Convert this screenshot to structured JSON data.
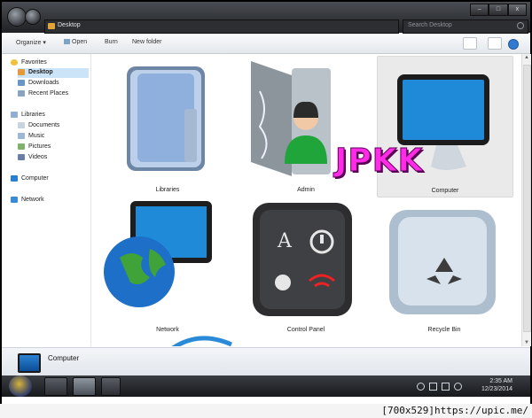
{
  "window": {
    "address_path": "Desktop",
    "search_placeholder": "Search Desktop",
    "controls": {
      "minimize": "–",
      "maximize": "□",
      "close": "x"
    }
  },
  "toolbar": {
    "organize": "Organize",
    "open": "Open",
    "burn": "Burn",
    "new_folder": "New folder"
  },
  "sidebar": {
    "favorites": "Favorites",
    "desktop": "Desktop",
    "downloads": "Downloads",
    "recent": "Recent Places",
    "libraries": "Libraries",
    "documents": "Documents",
    "music": "Music",
    "pictures": "Pictures",
    "videos": "Videos",
    "computer": "Computer",
    "network": "Network"
  },
  "items": [
    {
      "label": "Libraries"
    },
    {
      "label": "Admin"
    },
    {
      "label": "Computer"
    },
    {
      "label": "Network"
    },
    {
      "label": "Control Panel"
    },
    {
      "label": "Recycle Bin"
    }
  ],
  "details": {
    "label": "Computer"
  },
  "taskbar": {
    "time": "2:35 AM",
    "date": "12/23/2014"
  },
  "watermark": "JPKK",
  "footer": "[700x529]https://upic.me/"
}
